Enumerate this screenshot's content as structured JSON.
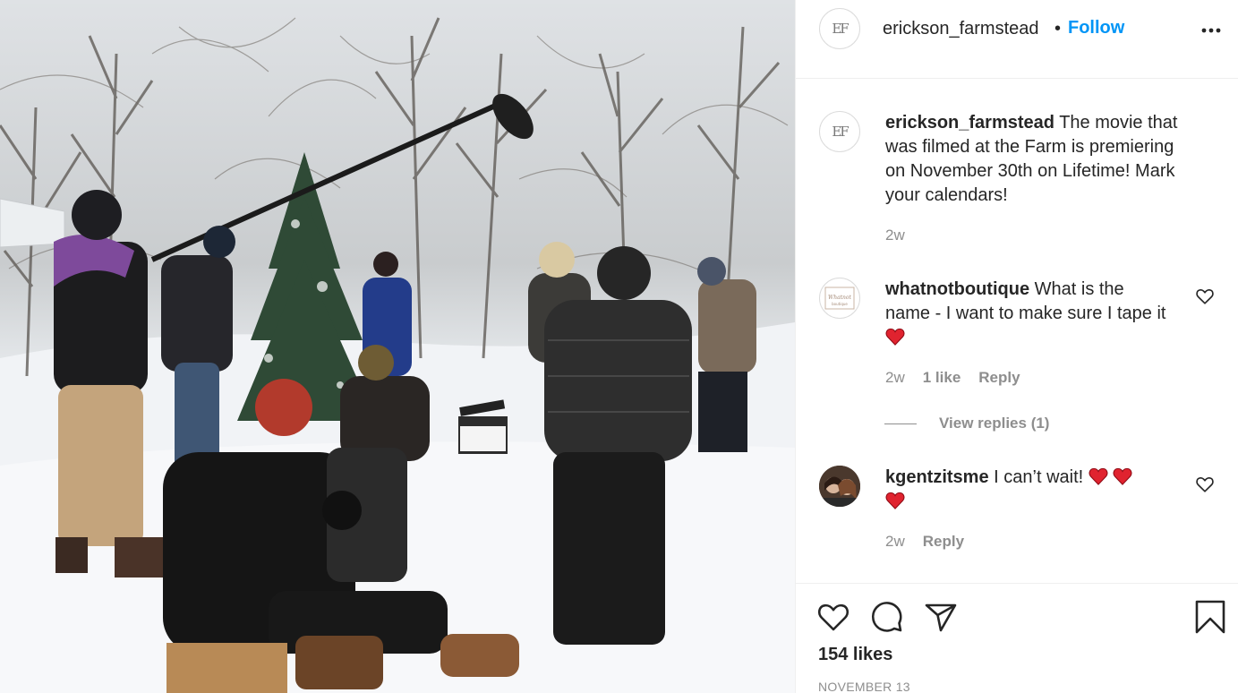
{
  "post": {
    "photo_alt": "Film crew shooting a scene in a snowy winter forest",
    "username": "erickson_farmstead",
    "avatar_monogram": "EF",
    "follow_label": "Follow",
    "separator": "•",
    "more_label": "•••"
  },
  "caption": {
    "username": "erickson_farmstead",
    "text": "The movie that was filmed at the Farm is premiering on November 30th on Lifetime! Mark your calendars!",
    "time": "2w"
  },
  "comments": [
    {
      "username": "whatnotboutique",
      "text": "What is the name - I want to make sure I tape it",
      "time": "2w",
      "likes": "1 like",
      "reply_label": "Reply",
      "view_replies": "View replies (1)"
    },
    {
      "username": "kgentzitsme",
      "text": "I can’t wait!",
      "time": "2w",
      "reply_label": "Reply"
    }
  ],
  "footer": {
    "likes": "154 likes",
    "date": "NOVEMBER 13"
  },
  "colors": {
    "accent": "#0095f6",
    "text": "#262626",
    "muted": "#8e8e8e",
    "heart_red": "#e0232f"
  },
  "icons": [
    "heart-icon",
    "comment-icon",
    "share-icon",
    "bookmark-icon",
    "more-icon"
  ]
}
